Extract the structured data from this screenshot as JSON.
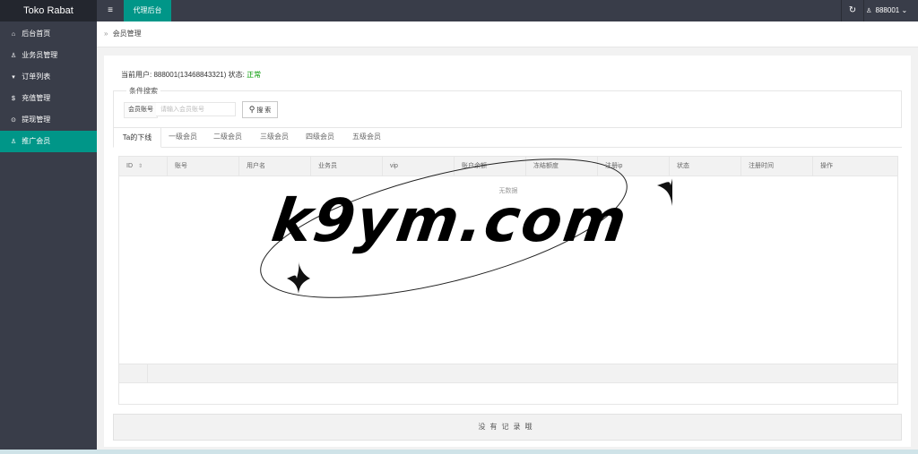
{
  "app": {
    "title": "Toko Rabat"
  },
  "sidebar": {
    "items": [
      {
        "label": "后台首页",
        "icon": "home-icon",
        "glyph": "⌂"
      },
      {
        "label": "业务员管理",
        "icon": "user-icon",
        "glyph": "♙"
      },
      {
        "label": "订单列表",
        "icon": "cart-icon",
        "glyph": "▾"
      },
      {
        "label": "充值管理",
        "icon": "dollar-icon",
        "glyph": "$"
      },
      {
        "label": "提现管理",
        "icon": "coin-icon",
        "glyph": "⊙"
      },
      {
        "label": "推广会员",
        "icon": "user-icon",
        "glyph": "♙",
        "active": true
      }
    ]
  },
  "topbar": {
    "menu_glyph": "≡",
    "tab": "代理后台",
    "refresh_glyph": "↻",
    "user_glyph": "♙",
    "user": "888001",
    "user_caret": "⌄"
  },
  "breadcrumb": {
    "arrow": "»",
    "label": "会员管理"
  },
  "current_user": {
    "prefix": "当前用户: 888001(13468843321) 状态: ",
    "status": "正常"
  },
  "search": {
    "legend": "条件搜索",
    "field_label": "会员账号",
    "placeholder": "请输入会员账号",
    "button_glyph": "⚲",
    "button_label": "搜 索"
  },
  "tabs": [
    "Ta的下线",
    "一级会员",
    "二级会员",
    "三级会员",
    "四级会员",
    "五级会员"
  ],
  "table": {
    "columns": [
      "ID",
      "账号",
      "用户名",
      "业务员",
      "vip",
      "账户余额",
      "冻结额度",
      "注册ip",
      "状态",
      "注册时间",
      "操作"
    ],
    "sort_glyph": "⇕",
    "empty_text": "无数据"
  },
  "no_record": "没有记录哦",
  "watermark": {
    "text": "k9ym.com"
  },
  "colors": {
    "accent": "#009688",
    "sidebar": "#393d49",
    "status_ok": "#009900"
  }
}
